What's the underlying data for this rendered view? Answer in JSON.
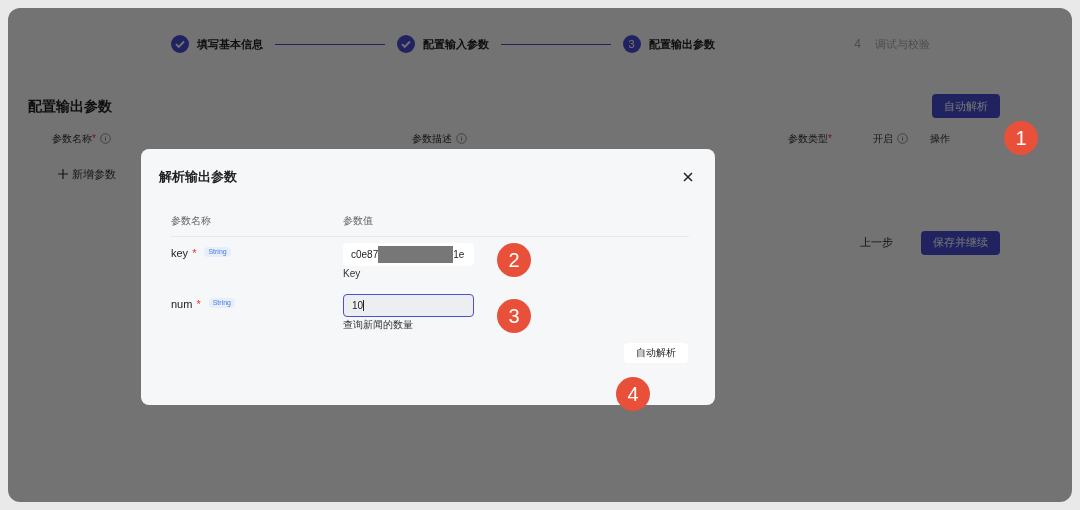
{
  "steps": [
    {
      "label": "填写基本信息",
      "completed": true,
      "selected": false
    },
    {
      "label": "配置输入参数",
      "completed": true,
      "selected": false
    },
    {
      "number": "3",
      "label": "配置输出参数",
      "completed": false,
      "selected": true
    },
    {
      "number": "4",
      "label": "调试与校验",
      "completed": false,
      "selected": false
    }
  ],
  "section_title": "配置输出参数",
  "auto_parse_button": "自动解析",
  "table": {
    "columns": [
      {
        "label": "参数名称",
        "mark": "*",
        "info": true
      },
      {
        "label": "参数描述",
        "info": true
      },
      {
        "label": "参数类型",
        "mark": "*",
        "info": false
      },
      {
        "label": "开启",
        "info": true
      },
      {
        "label": "操作",
        "info": false
      }
    ],
    "add_button": "新增参数"
  },
  "footer_buttons": [
    {
      "label": "上一步",
      "kind": "secondary"
    },
    {
      "label": "保存并继续",
      "kind": "primary"
    }
  ],
  "dialog": {
    "title": "解析输出参数",
    "columns": [
      "参数名称",
      "参数值"
    ],
    "params": [
      {
        "name": "key",
        "mark": "*",
        "type": "String",
        "value_parts": [
          "c0e87",
          "1e"
        ],
        "focused": false,
        "hint": "Key"
      },
      {
        "name": "num",
        "mark": "*",
        "type": "String",
        "value_parts": [
          "10"
        ],
        "focused": true,
        "hint": "查询新闻的数量"
      }
    ],
    "button": "自动解析"
  },
  "annotations": [
    "1",
    "2",
    "3",
    "4"
  ]
}
